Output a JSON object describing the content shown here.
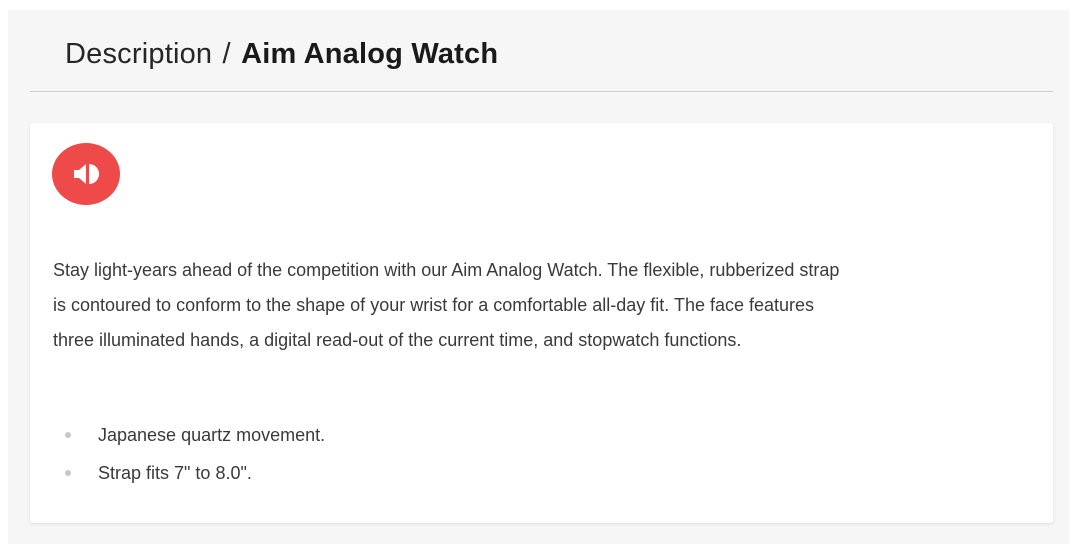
{
  "header": {
    "section_label": "Description",
    "separator": "/",
    "product_name": "Aim Analog Watch"
  },
  "audio_button": {
    "icon": "speaker-volume-icon",
    "color": "#ef4a4a"
  },
  "description": {
    "text": "Stay light-years ahead of the competition with our Aim Analog Watch. The flexible, rubberized strap is contoured to conform to the shape of your wrist for a comfortable all-day fit. The face features three illuminated hands, a digital read-out of the current time, and stopwatch functions."
  },
  "features": [
    "Japanese quartz movement.",
    "Strap fits 7\" to 8.0\"."
  ]
}
